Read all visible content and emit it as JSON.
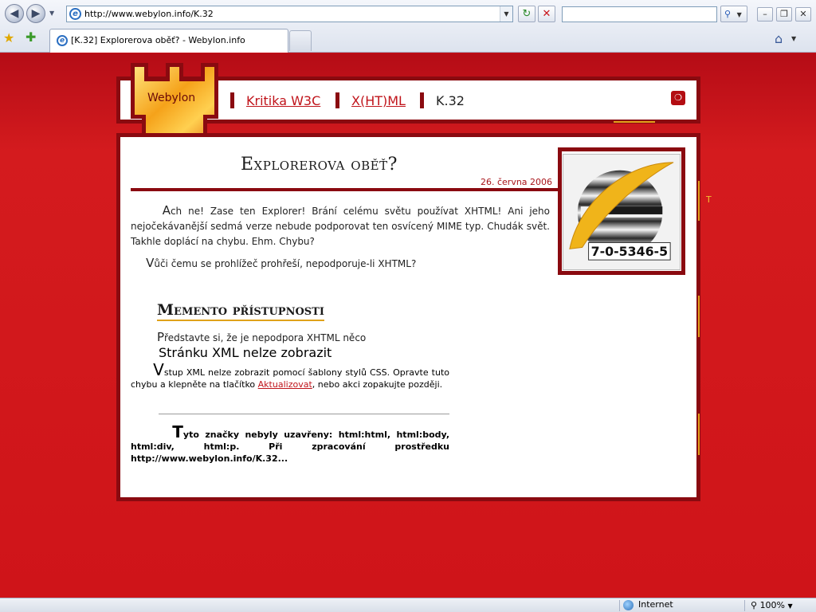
{
  "browser": {
    "address_url": "http://www.webylon.info/K.32",
    "tab_title": "[K.32] Explorerova oběť? - Webylon.info",
    "search_value": "",
    "status_zone": "Internet",
    "zoom": "100%"
  },
  "site": {
    "logo_text": "Webylon",
    "breadcrumbs": [
      {
        "label": "Kritika W3C",
        "link": true
      },
      {
        "label": "X(HT)ML",
        "link": true
      },
      {
        "label": "K.32",
        "link": false
      }
    ],
    "side_letter": "T"
  },
  "article": {
    "title": "Explorerova oběť?",
    "date": "26. června 2006",
    "p1_cap": "A",
    "p1_text": "ch ne! Zase ten Explorer! Brání celému světu používat XHTML! Ani jeho nejočekávanější sedmá verze nebude podporovat ten osvícený MIME typ. Chudák svět. Takhle doplácí na chybu. Ehm. Chybu?",
    "p2_cap": "V",
    "p2_text": "ůči čemu se prohlížeč prohřeší, nepodporuje-li XHTML?",
    "image_caption": "7-0-5346-5"
  },
  "memento": {
    "heading": "Memento přístupnosti",
    "intro_cap": "P",
    "intro_text": "ředstavte si, že je nepodpora XHTML něco",
    "xml_title": "Stránku XML nelze zobrazit",
    "xml_body_cap": "V",
    "xml_body_before": "stup XML nelze zobrazit pomocí šablony stylů CSS. Opravte tuto chybu a klepněte na tlačítko ",
    "xml_body_link": "Aktualizovat",
    "xml_body_after": ", nebo akci zopakujte později.",
    "xml_detail_cap": "T",
    "xml_detail_text": "yto značky nebyly uzavřeny: html:html, html:body, html:div, html:p. Při zpracování prostředku http://www.webylon.info/K.32..."
  },
  "colors": {
    "page_red": "#cf1419",
    "frame_dark_red": "#8a0a10",
    "link_red": "#c0141b",
    "gold": "#e3a21a"
  }
}
